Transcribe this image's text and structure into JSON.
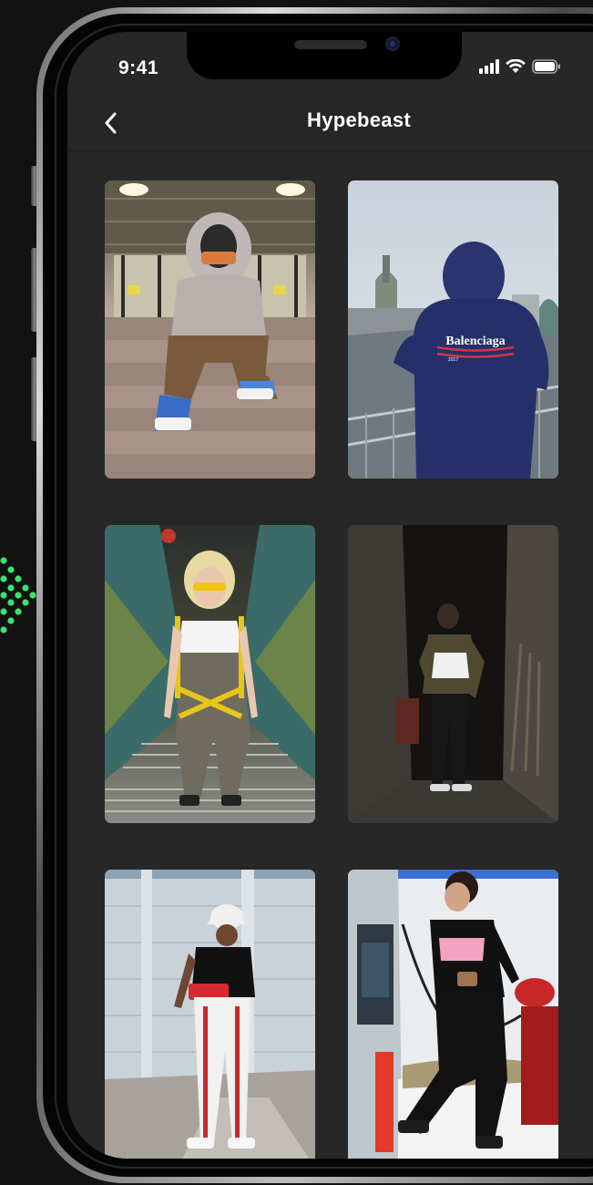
{
  "status_bar": {
    "time": "9:41",
    "icons": [
      "signal-icon",
      "wifi-icon",
      "battery-icon"
    ]
  },
  "nav": {
    "back_icon": "chevron-left-icon",
    "title": "Hypebeast"
  },
  "gallery": {
    "items": [
      {
        "subject": "hooded person sitting on stairs",
        "overlay_text": ""
      },
      {
        "subject": "person in navy hoodie facing away",
        "overlay_text": "Balenciaga",
        "overlay_subtext": "2017"
      },
      {
        "subject": "woman in yellow glasses on subway stairs",
        "overlay_text": ""
      },
      {
        "subject": "person standing in dark alley",
        "overlay_text": ""
      },
      {
        "subject": "person in bucket hat and track pants",
        "overlay_text": ""
      },
      {
        "subject": "person at gas pump",
        "overlay_text": ""
      }
    ]
  },
  "colors": {
    "screen_bg": "#272727",
    "page_bg": "#121212",
    "accent_dots": "#39e26b",
    "text": "#ffffff"
  }
}
